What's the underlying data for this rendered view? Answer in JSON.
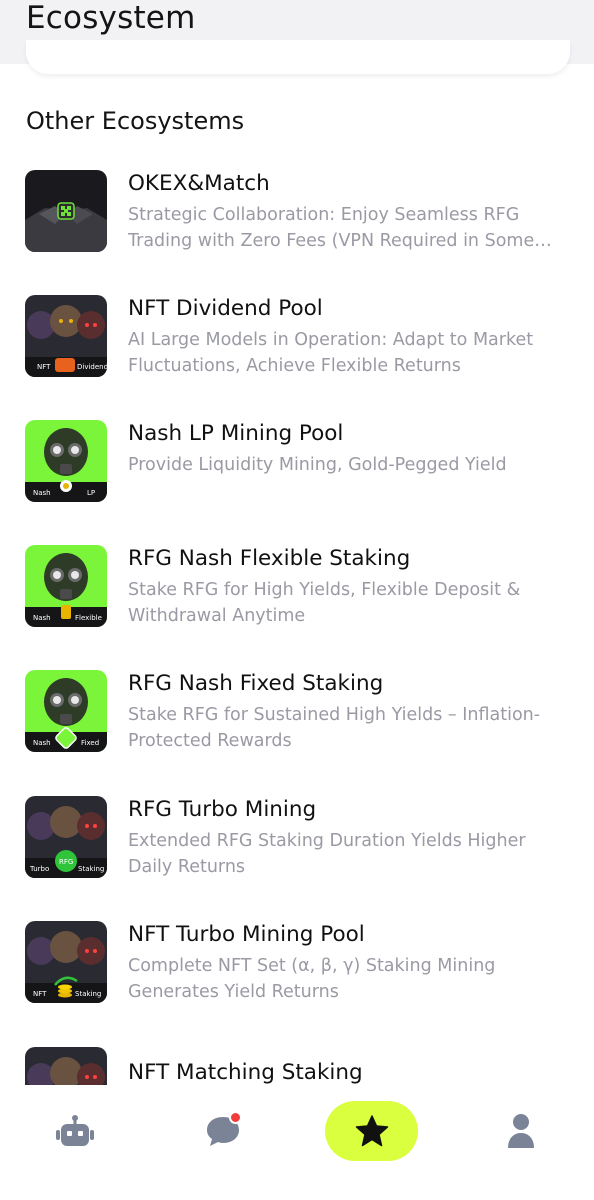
{
  "header": {
    "title": "Ecosystem"
  },
  "section": {
    "title": "Other Ecosystems"
  },
  "items": [
    {
      "title": "OKEX&Match",
      "description": "Strategic Collaboration: Enjoy Seamless RFG Trading with Zero Fees (VPN Required in Some Regions)",
      "thumb_label_left": "",
      "thumb_label_right": ""
    },
    {
      "title": "NFT Dividend Pool",
      "description": "AI Large Models in Operation: Adapt to Market Fluctuations, Achieve Flexible Returns",
      "thumb_label_left": "NFT",
      "thumb_label_right": "Dividend"
    },
    {
      "title": "Nash LP Mining Pool",
      "description": "Provide Liquidity Mining, Gold-Pegged Yield",
      "thumb_label_left": "Nash",
      "thumb_label_right": "LP"
    },
    {
      "title": "RFG Nash Flexible Staking",
      "description": "Stake RFG for High Yields, Flexible Deposit & Withdrawal Anytime",
      "thumb_label_left": "Nash",
      "thumb_label_right": "Flexible"
    },
    {
      "title": "RFG Nash Fixed Staking",
      "description": "Stake RFG for Sustained High Yields – Inflation-Protected Rewards",
      "thumb_label_left": "Nash",
      "thumb_label_right": "Fixed"
    },
    {
      "title": "RFG Turbo Mining",
      "description": "Extended RFG Staking Duration Yields Higher Daily Returns",
      "thumb_label_left": "Turbo",
      "thumb_label_right": "Staking",
      "thumb_label_center": "RFG"
    },
    {
      "title": "NFT Turbo Mining Pool",
      "description": "Complete NFT Set (α, β, γ) Staking Mining Generates Yield Returns",
      "thumb_label_left": "NFT",
      "thumb_label_right": "Staking"
    },
    {
      "title": "NFT Matching Staking",
      "description": "",
      "thumb_label_left": "",
      "thumb_label_right": ""
    }
  ],
  "nav": [
    {
      "icon": "robot-icon",
      "active": false
    },
    {
      "icon": "chat-bubble-icon",
      "active": false,
      "badge": true
    },
    {
      "icon": "star-icon",
      "active": true
    },
    {
      "icon": "user-icon",
      "active": false
    }
  ],
  "colors": {
    "accent": "#d9ff3f",
    "thumb_green": "#7bf53a",
    "thumb_dark": "#2a2a33",
    "badge_red": "#f23b3b",
    "muted_text": "#9a9aa4"
  }
}
